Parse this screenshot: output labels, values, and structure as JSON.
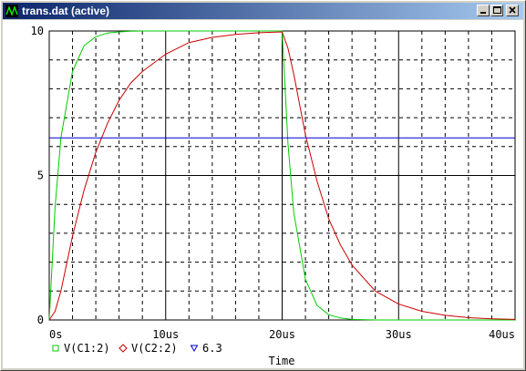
{
  "window": {
    "title": "trans.dat (active)"
  },
  "controls": {
    "minimize_icon": "minimize-icon",
    "maximize_icon": "maximize-icon",
    "close_icon": "close-icon"
  },
  "chart_data": {
    "type": "line",
    "title": "",
    "xlabel": "Time",
    "ylabel": "",
    "xlim": [
      0,
      40
    ],
    "ylim": [
      0,
      10
    ],
    "x_unit": "us",
    "x_ticks": [
      0,
      10,
      20,
      30,
      40
    ],
    "x_tick_labels": [
      "0s",
      "10us",
      "20us",
      "30us",
      "40us"
    ],
    "y_ticks": [
      0,
      5,
      10
    ],
    "y_tick_labels": [
      "0",
      "5",
      "10"
    ],
    "grid": "dotted",
    "legend_position": "bottom-left",
    "x": [
      0,
      0.5,
      1,
      2,
      3,
      4,
      5,
      6,
      7,
      8,
      10,
      12,
      14,
      16,
      18,
      20,
      20.5,
      21,
      22,
      23,
      24,
      25,
      26,
      28,
      30,
      32,
      34,
      36,
      38,
      40
    ],
    "series": [
      {
        "name": "V(C1:2)",
        "color": "#00cc00",
        "marker": "square",
        "values": [
          0,
          3.9,
          6.3,
          8.6,
          9.5,
          9.8,
          9.93,
          9.97,
          9.99,
          10,
          10,
          10,
          10,
          10,
          10,
          10,
          6.1,
          3.7,
          1.4,
          0.5,
          0.18,
          0.07,
          0.02,
          0,
          0,
          0,
          0,
          0,
          0,
          0
        ]
      },
      {
        "name": "V(C2:2)",
        "color": "#cc0000",
        "marker": "diamond",
        "values": [
          0,
          0.3,
          1.0,
          2.9,
          4.5,
          5.8,
          6.8,
          7.6,
          8.2,
          8.6,
          9.2,
          9.6,
          9.78,
          9.88,
          9.94,
          9.97,
          9.4,
          8.5,
          6.4,
          4.8,
          3.5,
          2.6,
          1.9,
          1.0,
          0.55,
          0.3,
          0.16,
          0.08,
          0.04,
          0.02
        ]
      },
      {
        "name": "6.3",
        "color": "#0000cc",
        "marker": "triangle",
        "values": [
          6.3,
          6.3,
          6.3,
          6.3,
          6.3,
          6.3,
          6.3,
          6.3,
          6.3,
          6.3,
          6.3,
          6.3,
          6.3,
          6.3,
          6.3,
          6.3,
          6.3,
          6.3,
          6.3,
          6.3,
          6.3,
          6.3,
          6.3,
          6.3,
          6.3,
          6.3,
          6.3,
          6.3,
          6.3,
          6.3
        ]
      }
    ]
  }
}
